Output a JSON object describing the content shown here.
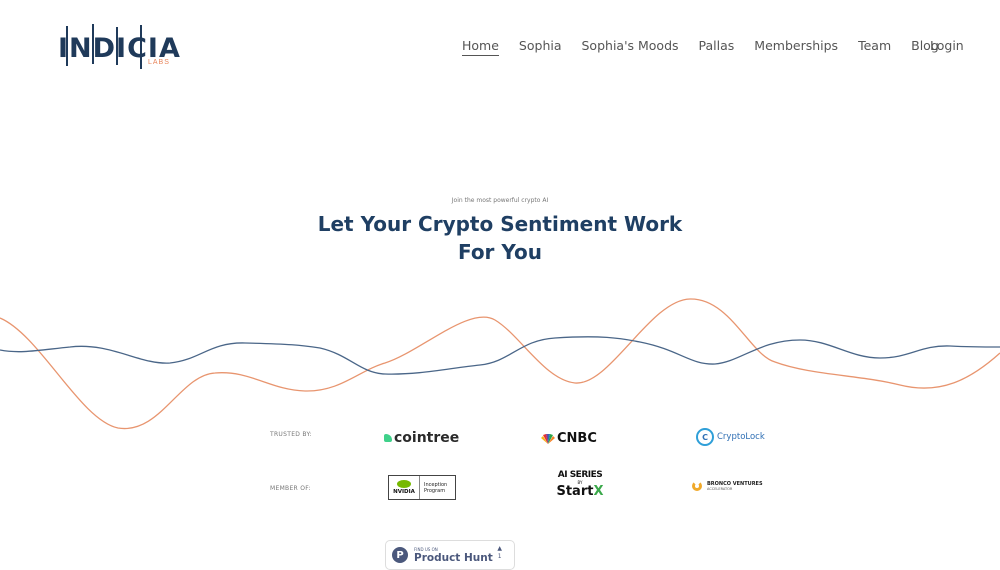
{
  "header": {
    "logo": {
      "word": "INDICIA",
      "sub": "LABS"
    },
    "nav": [
      {
        "label": "Home",
        "active": true
      },
      {
        "label": "Sophia"
      },
      {
        "label": "Sophia's Moods"
      },
      {
        "label": "Pallas"
      },
      {
        "label": "Memberships"
      },
      {
        "label": "Team"
      },
      {
        "label": "Blog"
      }
    ],
    "login_label": "Login"
  },
  "hero": {
    "eyebrow": "Join the most powerful crypto AI",
    "title_line1": "Let Your Crypto Sentiment Work",
    "title_line2": "For You"
  },
  "colors": {
    "brand_navy": "#1f3f63",
    "wave_blue": "#4a6688",
    "wave_orange": "#e8956f"
  },
  "trusted_by": {
    "label": "TRUSTED BY:",
    "logos": [
      "cointree",
      "CNBC",
      "CryptoLock"
    ]
  },
  "member_of": {
    "label": "MEMBER OF:",
    "nvidia": {
      "brand": "NVIDIA",
      "line1": "Inception",
      "line2": "Program"
    },
    "startx": {
      "line1": "AI SERIES",
      "by": "BY",
      "brand_a": "Start",
      "brand_b": "X"
    },
    "bronco": {
      "line1": "BRONCO VENTURES",
      "line2": "ACCELERATOR"
    }
  },
  "product_hunt": {
    "small": "FIND US ON",
    "big": "Product Hunt",
    "votes": "1"
  }
}
